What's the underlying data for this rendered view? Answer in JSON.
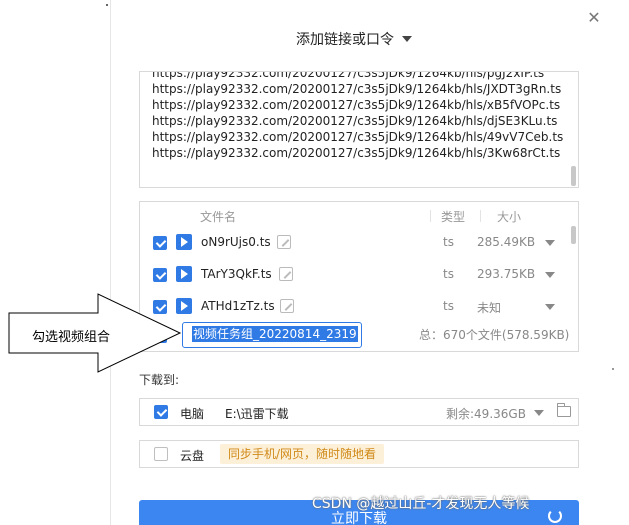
{
  "dialog": {
    "title": "添加链接或口令",
    "close_icon": "close-icon"
  },
  "url_list": {
    "partial_top": "https://play92332.com/20200127/c3s5jDk9/1264kb/hls/pgJ2xIP.ts",
    "lines": [
      "https://play92332.com/20200127/c3s5jDk9/1264kb/hls/JXDT3gRn.ts",
      "https://play92332.com/20200127/c3s5jDk9/1264kb/hls/xB5fVOPc.ts",
      "https://play92332.com/20200127/c3s5jDk9/1264kb/hls/djSE3KLu.ts",
      "https://play92332.com/20200127/c3s5jDk9/1264kb/hls/49vV7Ceb.ts",
      "https://play92332.com/20200127/c3s5jDk9/1264kb/hls/3Kw68rCt.ts"
    ]
  },
  "file_list": {
    "header": {
      "name": "文件名",
      "type": "类型",
      "size": "大小"
    },
    "rows": [
      {
        "name": "oN9rUjs0.ts",
        "type": "ts",
        "size": "285.49KB",
        "checked": true
      },
      {
        "name": "TArY3QkF.ts",
        "type": "ts",
        "size": "293.75KB",
        "checked": true
      },
      {
        "name": "ATHd1zTz.ts",
        "type": "ts",
        "size": "未知",
        "checked": true
      }
    ],
    "group": {
      "checked": true,
      "name_value": "视频任务组_20220814_2319",
      "summary": "总：670个文件(578.59KB)"
    }
  },
  "download_to": {
    "label": "下载到:",
    "pc": {
      "name": "电脑",
      "path": "E:\\迅雷下载",
      "free": "剩余:49.36GB",
      "checked": true
    },
    "cloud": {
      "name": "云盘",
      "tip": "同步手机/网页，随时随地看",
      "checked": false
    }
  },
  "download_button": {
    "label": "立即下载"
  },
  "annotation": {
    "text": "勾选视频组合"
  },
  "watermark": "CSDN @越过山丘-才发现无人等候",
  "colors": {
    "accent": "#2f7ae5",
    "button": "#3b86f0",
    "tip_bg": "#fdf0d8",
    "tip_text": "#d08a1a"
  }
}
